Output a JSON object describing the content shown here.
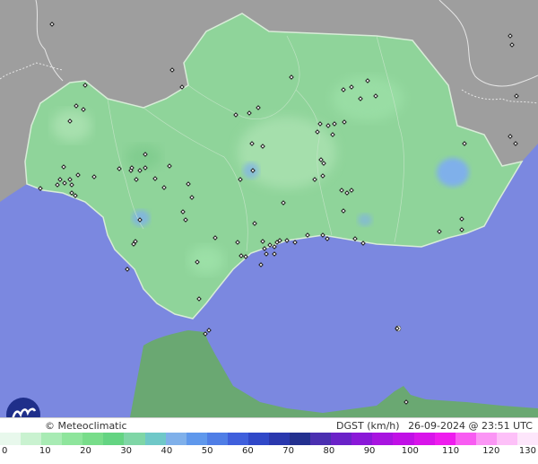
{
  "footer": {
    "brand": "© Meteoclimatic",
    "variable": "DGST (km/h)",
    "timestamp": "26-09-2024 @ 23:51 UTC"
  },
  "legend": {
    "tick_labels": [
      "0",
      "10",
      "20",
      "30",
      "40",
      "50",
      "60",
      "70",
      "80",
      "90",
      "100",
      "110",
      "120",
      "130"
    ],
    "colors": [
      "#e8f8ec",
      "#c9f2d0",
      "#a8ebb4",
      "#8ee59c",
      "#78dd8a",
      "#64d482",
      "#7fd6a6",
      "#6fc8c8",
      "#7fb0ea",
      "#5f98ec",
      "#4f7ee6",
      "#3f5fdc",
      "#3048c8",
      "#2a38ae",
      "#23308f",
      "#4a2fb0",
      "#6a22c8",
      "#8a18d8",
      "#a814e0",
      "#c010e6",
      "#d814ea",
      "#ee1cee",
      "#f85cf2",
      "#fb96f5",
      "#fdc0f8",
      "#fde6fb"
    ]
  },
  "map": {
    "colors": {
      "sea": "#7b88e0",
      "land_andalusia": "#8fd49a",
      "land_other": "#9e9e9e",
      "africa": "#6aa872"
    }
  }
}
